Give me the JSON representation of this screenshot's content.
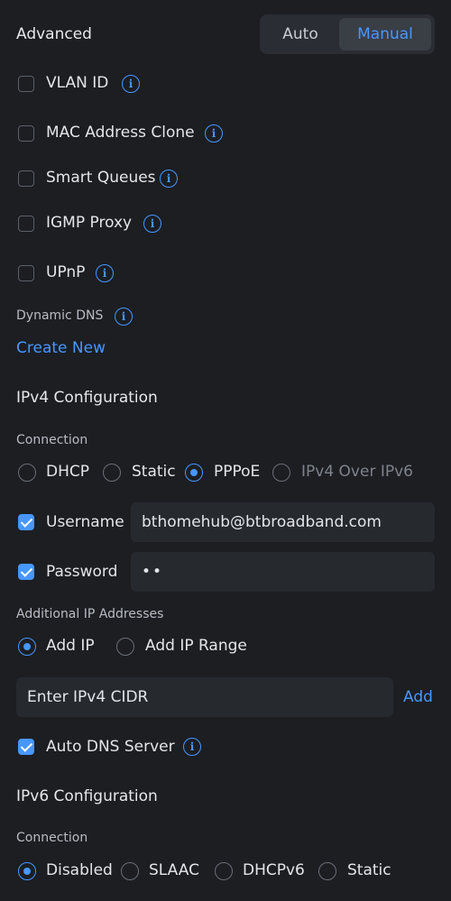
{
  "header": {
    "title": "Advanced",
    "mode_auto": "Auto",
    "mode_manual": "Manual"
  },
  "options": {
    "vlan_id": "VLAN ID",
    "mac_clone": "MAC Address Clone",
    "smart_queues": "Smart Queues",
    "igmp_proxy": "IGMP Proxy",
    "upnp": "UPnP"
  },
  "info_glyph": "i",
  "ddns": {
    "label": "Dynamic DNS",
    "create_new": "Create New"
  },
  "ipv4": {
    "heading": "IPv4 Configuration",
    "connection_label": "Connection",
    "connection_options": [
      "DHCP",
      "Static",
      "PPPoE",
      "IPv4 Over IPv6"
    ],
    "selected_connection": "PPPoE",
    "username_label": "Username",
    "username_value": "bthomehub@btbroadband.com",
    "password_label": "Password",
    "password_value": "••",
    "additional_ip_label": "Additional IP Addresses",
    "add_ip": "Add IP",
    "add_ip_range": "Add IP Range",
    "cidr_placeholder": "Enter IPv4 CIDR",
    "add_button": "Add",
    "auto_dns": "Auto DNS Server"
  },
  "ipv6": {
    "heading": "IPv6 Configuration",
    "connection_label": "Connection",
    "connection_options": [
      "Disabled",
      "SLAAC",
      "DHCPv6",
      "Static"
    ],
    "selected_connection": "Disabled"
  },
  "colors": {
    "accent": "#4797ff",
    "background": "#1c1e22",
    "field": "#26292e"
  }
}
